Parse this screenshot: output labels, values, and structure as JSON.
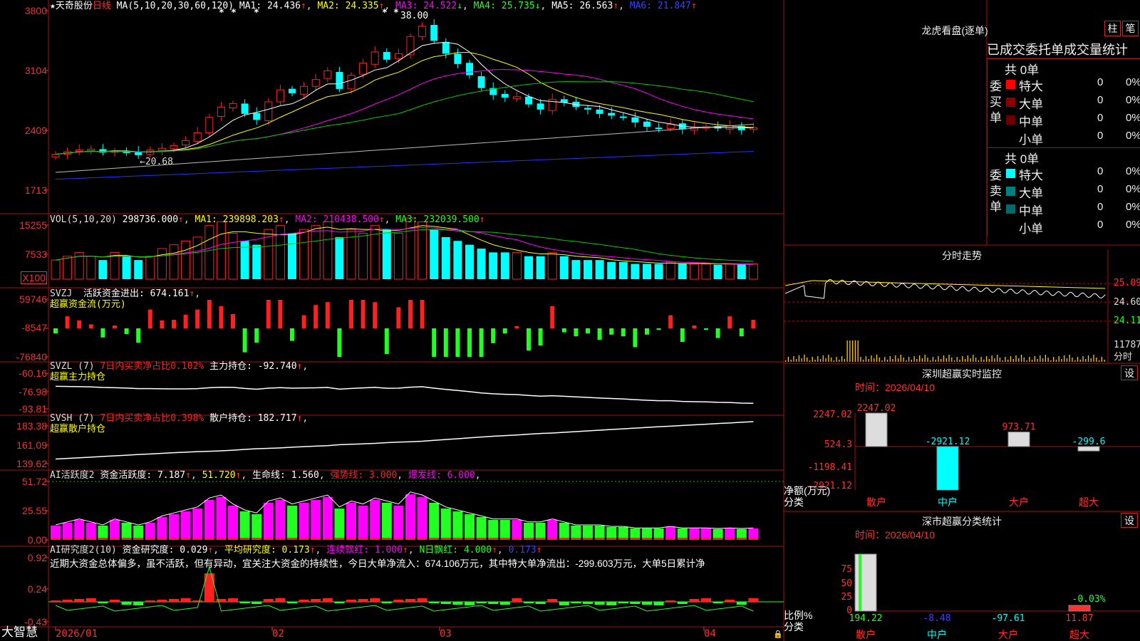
{
  "colors": {
    "up": "#ff2020",
    "down": "#00ffff",
    "ma1": "#ffffff",
    "ma2": "#ffff00",
    "ma3": "#ff00ff",
    "ma4": "#00cc00",
    "ma5": "#bbbbbb",
    "ma6": "#2222ff",
    "frame": "#aa1111",
    "green": "#22ff22"
  },
  "main_chart": {
    "title": "★天奇股份",
    "period": "日线",
    "ma_label": "MA(5,10,20,30,60,120)",
    "ma1": "MA1: 24.436",
    "ma2": "MA2: 24.335",
    "ma3": "MA3: 24.522",
    "ma4": "MA4: 25.735",
    "ma5": "MA5: 26.563",
    "ma6": "MA6: 21.847",
    "axis": [
      "3800",
      "3104",
      "2409",
      "1713"
    ],
    "high_label": "38.00",
    "low_label": "←20.68",
    "stars": [
      "*",
      "*",
      "*",
      "*",
      "*"
    ]
  },
  "vol_panel": {
    "title": "VOL(5,10,20)",
    "value": "298736.000",
    "ma1": "MA1: 239898.203",
    "ma2": "MA2: 210438.500",
    "ma3": "MA3: 232039.500",
    "axis": [
      "15255",
      "7533"
    ],
    "unit": "X100"
  },
  "svzj_panel": {
    "title": "SVZJ",
    "label": "活跃资金进出: 674.161",
    "sub": "超赢资金流(万元)",
    "axis": [
      "59746",
      "-8547",
      "-76840"
    ]
  },
  "svzl_panel": {
    "title": "SVZL (7)",
    "label1": "7日内买卖净占比0.102%",
    "label2": "主力持仓: -92.740",
    "sub": "超赢主力持仓",
    "axis": [
      "-60.16",
      "-76.98",
      "-93.81"
    ]
  },
  "svsh_panel": {
    "title": "SVSH (7)",
    "label1": "7日内买卖净占比0.398%",
    "label2": "散户持仓: 182.717",
    "sub": "超赢散户持仓",
    "axis": [
      "183.38",
      "161.09",
      "139.62"
    ]
  },
  "ai_panel": {
    "title": "AI活跃度2",
    "label1": "资金活跃度: 7.187",
    "label2": "51.720",
    "label3": "生命线: 1.560",
    "label4": "强势线: 3.000",
    "label5": "爆发线: 6.000",
    "axis": [
      "51.72",
      "25.55",
      "0.00"
    ]
  },
  "ai2_panel": {
    "title": "AI研究度2(10)",
    "label1": "资金研究度: 0.029",
    "label2": "平均研究度: 0.173",
    "label3": "连续飘红: 1.000",
    "label4": "N日飘红: 4.000",
    "label5": "0.173",
    "comment": "近期大资金总体偏多，虽不活跃，但有异动，宜关注大资金的持续性，今日大单净流入：674.106万元，其中特大单净流出：-299.603万元，大单5日累计净",
    "axis": [
      "0.92",
      "0.24",
      "-0.43"
    ]
  },
  "bottom_axis": {
    "brand": "大智慧",
    "dates": [
      "2026/01",
      "02",
      "03",
      "04"
    ]
  },
  "longhu": {
    "title": "龙虎看盘(逐单)",
    "tab1": "柱",
    "tab2": "笔",
    "header": "已成交委托单成交量统计",
    "buy_group": "委买单",
    "sell_group": "委卖单",
    "buy_total": "共 0单",
    "sell_total": "共 0单",
    "buy_rows": [
      {
        "name": "特大",
        "count": "0",
        "pct": "0%",
        "color": "#ff0000"
      },
      {
        "name": "大单",
        "count": "0",
        "pct": "0%",
        "color": "#8b0000"
      },
      {
        "name": "中单",
        "count": "0",
        "pct": "0%",
        "color": "#6b0000"
      },
      {
        "name": "小单",
        "count": "0",
        "pct": "0%",
        "color": "#000000"
      }
    ],
    "sell_rows": [
      {
        "name": "特大",
        "count": "0",
        "pct": "0%",
        "color": "#00ffff"
      },
      {
        "name": "大单",
        "count": "0",
        "pct": "0%",
        "color": "#008080"
      },
      {
        "name": "中单",
        "count": "0",
        "pct": "0%",
        "color": "#006b6b"
      },
      {
        "name": "小单",
        "count": "0",
        "pct": "0%",
        "color": "#000000"
      }
    ]
  },
  "intraday": {
    "title": "分时走势",
    "axis": [
      "25.09",
      "24.60",
      "24.11",
      "11787"
    ],
    "unit": "分时"
  },
  "monitor": {
    "title": "深圳超赢实时监控",
    "setting": "设",
    "time": "时间：2026/04/10",
    "axis": [
      "2247.02",
      "524.3",
      "-1198.41",
      "-2921.12"
    ],
    "ylabel": "净额(万元)",
    "xlabel": "分类",
    "chart_data": {
      "type": "bar",
      "categories": [
        "散户",
        "中户",
        "大户",
        "超大"
      ],
      "values": [
        2247.02,
        -2921.12,
        973.71,
        -299.6
      ],
      "labels": [
        "2247.02",
        "-2921.12",
        "973.71",
        "-299.6"
      ],
      "ylim": [
        -2921.12,
        2247.02
      ],
      "title": "深圳超赢实时监控",
      "ylabel": "净额(万元)",
      "xlabel": "分类"
    }
  },
  "classify": {
    "title": "深市超赢分类统计",
    "setting": "设",
    "time": "时间：2026/04/10",
    "axis": [
      "75",
      "50",
      "25",
      "0"
    ],
    "ylabel": "比例%",
    "xlabel": "分类",
    "chart_data": {
      "type": "bar",
      "categories": [
        "散户",
        "中户",
        "大户",
        "超大"
      ],
      "values": [
        194.22,
        -8.48,
        -97.61,
        11.87
      ],
      "labels": [
        "194.22",
        "-8.48",
        "-97.61",
        "11.87"
      ],
      "extra_label": "-0.03%",
      "ylim": [
        0,
        100
      ],
      "title": "深市超赢分类统计",
      "ylabel": "比例%",
      "xlabel": "分类"
    }
  }
}
